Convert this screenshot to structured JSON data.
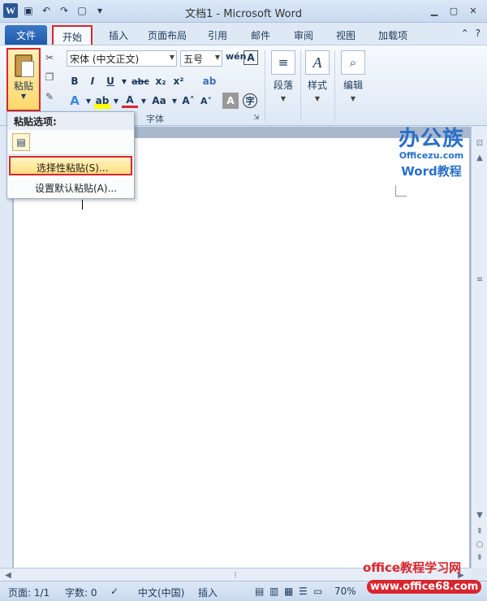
{
  "window": {
    "title": "文档1 - Microsoft Word"
  },
  "tabs": [
    {
      "label": "文件"
    },
    {
      "label": "开始"
    },
    {
      "label": "插入"
    },
    {
      "label": "页面布局"
    },
    {
      "label": "引用"
    },
    {
      "label": "邮件"
    },
    {
      "label": "审阅"
    },
    {
      "label": "视图"
    },
    {
      "label": "加载项"
    }
  ],
  "ribbon": {
    "paste_label": "粘贴",
    "font_name": "宋体 (中文正文)",
    "font_size": "五号",
    "font_group_label": "字体",
    "paragraph_label": "段落",
    "styles_label": "样式",
    "editing_label": "编辑"
  },
  "paste_menu": {
    "header": "粘贴选项:",
    "items": [
      {
        "label": "选择性粘贴(S)..."
      },
      {
        "label": "设置默认粘贴(A)..."
      }
    ]
  },
  "status": {
    "page": "页面: 1/1",
    "words": "字数: 0",
    "language": "中文(中国)",
    "insert_mode": "插入",
    "zoom": "70%"
  },
  "watermark": {
    "brand": "办公族",
    "site": "Officezu.com",
    "subtitle": "Word教程",
    "bottom_text": "office教程学习网",
    "bottom_url": "www.office68.com"
  },
  "colors": {
    "accent_red": "#d8262e",
    "file_tab": "#2b5797",
    "highlight": "#ffdf80"
  }
}
